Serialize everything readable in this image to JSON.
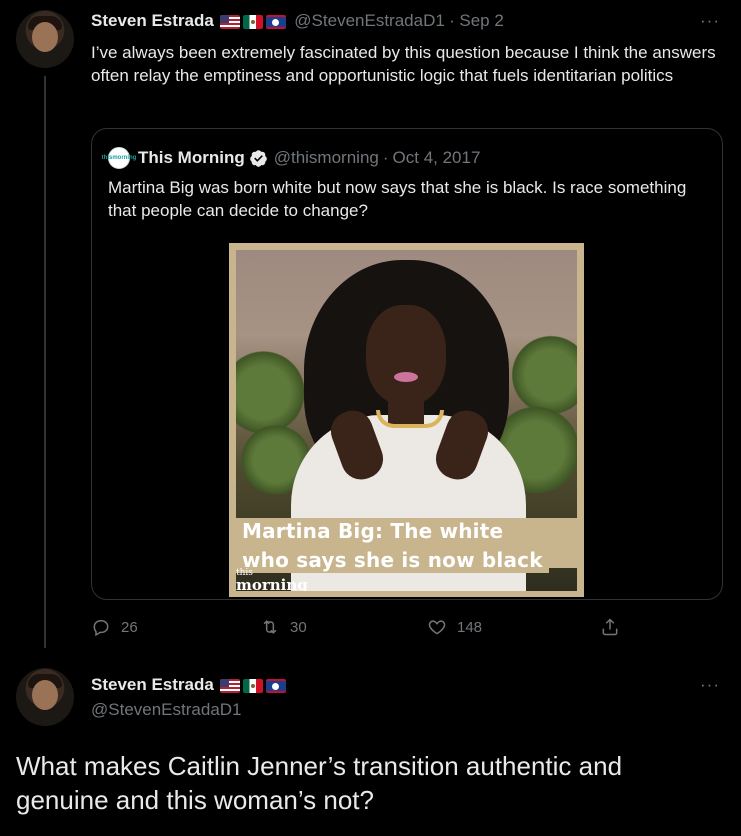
{
  "tweet": {
    "author_name": "Steven Estrada",
    "handle": "@StevenEstradaD1",
    "separator": "·",
    "date": "Sep 2",
    "flags": [
      "us-flag",
      "mexico-flag",
      "belize-flag"
    ],
    "text": "I’ve always been extremely fascinated by this question because I think the answers often relay the emptiness and opportunistic logic that fuels identitarian politics",
    "more_label": "···",
    "actions": {
      "replies": "26",
      "retweets": "30",
      "likes": "148"
    }
  },
  "quoted_tweet": {
    "author_name": "This Morning",
    "handle": "@thismorning",
    "separator": "·",
    "date": "Oct 4, 2017",
    "avatar_text": "thismorning",
    "text": "Martina Big was born white but now says that she is black. Is race something that people can decide to change?",
    "media": {
      "caption_line1": "Martina Big: The white woman",
      "caption_line2": "who says she is now black",
      "logo_small": "this",
      "logo_large": "morning"
    }
  },
  "reply": {
    "author_name": "Steven Estrada",
    "handle": "@StevenEstradaD1",
    "flags": [
      "us-flag",
      "mexico-flag",
      "belize-flag"
    ],
    "more_label": "···",
    "text": "What makes Caitlin Jenner’s transition authentic and genuine and this woman’s not?"
  },
  "colors": {
    "background": "#000000",
    "text": "#e7e9ea",
    "muted": "#71767b",
    "border": "#2f3336",
    "verified": "#1d9bf0",
    "media_frame": "#c8b48d"
  }
}
